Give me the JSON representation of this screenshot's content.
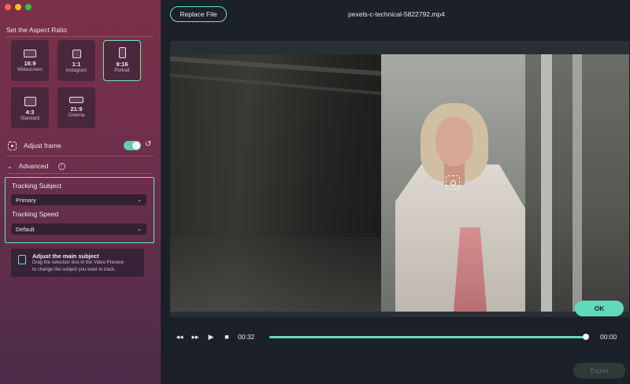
{
  "window": {
    "traffic_lights": [
      "close",
      "minimize",
      "zoom"
    ]
  },
  "sidebar": {
    "section_title": "Set the Aspect Ratio",
    "ratios": [
      {
        "label": "16:9",
        "sub": "Widescreen",
        "icon": "widescreen-ratio-icon",
        "selected": false
      },
      {
        "label": "1:1",
        "sub": "Instagram",
        "icon": "square-ratio-icon",
        "selected": false
      },
      {
        "label": "9:16",
        "sub": "Portrait",
        "icon": "portrait-ratio-icon",
        "selected": true
      },
      {
        "label": "4:3",
        "sub": "Standard",
        "icon": "standard-ratio-icon",
        "selected": false
      },
      {
        "label": "21:9",
        "sub": "Cinema",
        "icon": "cinema-ratio-icon",
        "selected": false
      }
    ],
    "adjust_frame": {
      "label": "Adjust frame",
      "enabled": true
    },
    "advanced": {
      "label": "Advanced",
      "info": "i"
    },
    "tracking_subject": {
      "label": "Tracking Subject",
      "value": "Primary"
    },
    "tracking_speed": {
      "label": "Tracking Speed",
      "value": "Default"
    },
    "hint": {
      "title": "Adjust the main subject",
      "desc_line1": "Drag the selection box in the Video Preview",
      "desc_line2": "to change the subject you want to track."
    }
  },
  "main": {
    "replace_button": "Replace File",
    "file_name": "pexels-c-technical-5822792.mp4",
    "ok_button": "OK",
    "playback": {
      "current_time": "00:32",
      "end_time": "00:00",
      "progress": 1.0
    },
    "export_button": "Export"
  },
  "colors": {
    "accent": "#62d9b8",
    "accent_border": "#6fe3c6",
    "sidebar_top": "#7b3049",
    "sidebar_bottom": "#4b2c48",
    "main_bg": "#1c2027"
  }
}
